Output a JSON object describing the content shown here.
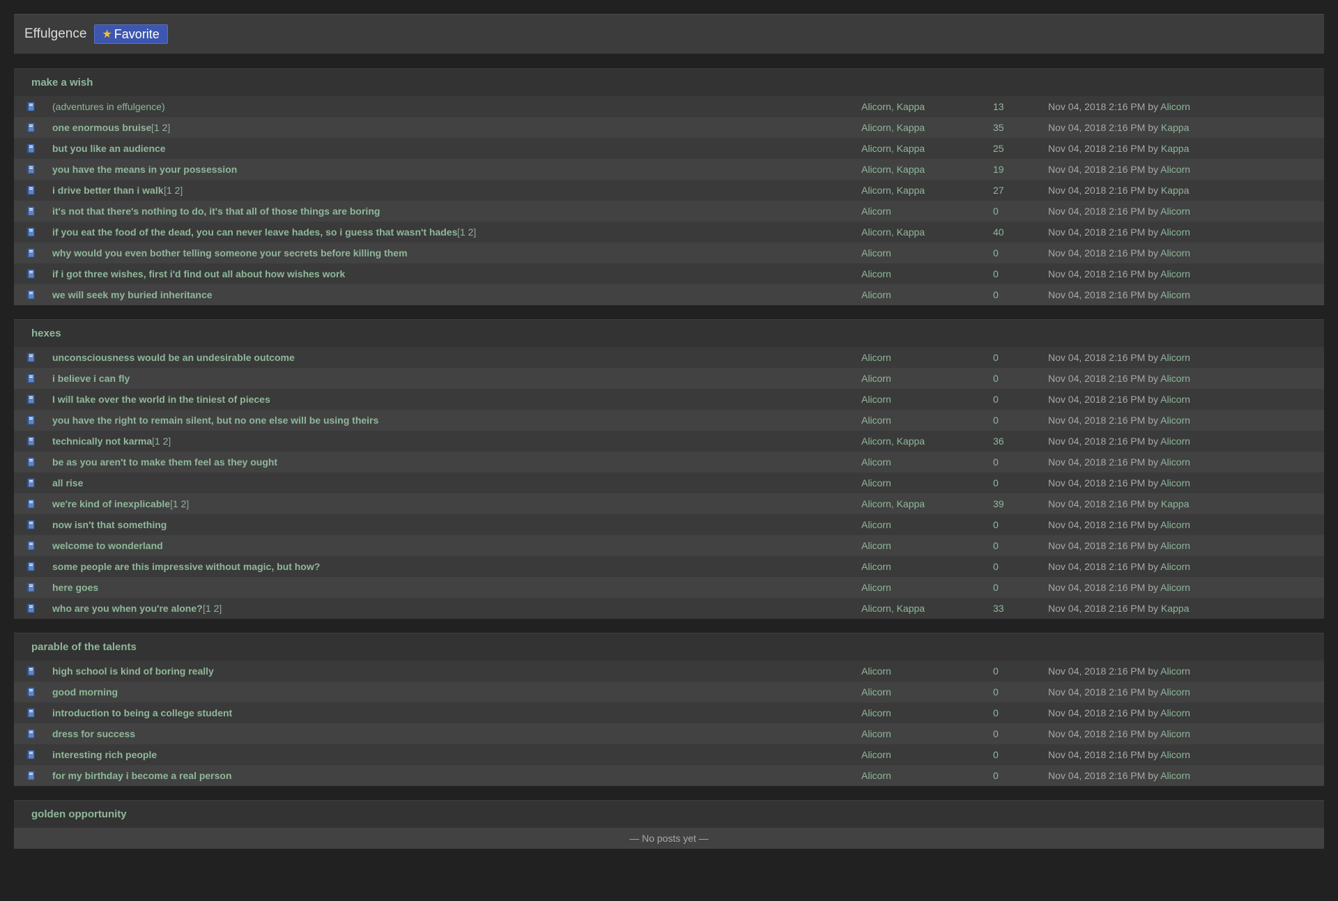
{
  "header": {
    "title": "Effulgence",
    "favorite_label": "Favorite"
  },
  "sections": [
    {
      "name": "make a wish",
      "rows": [
        {
          "title": "(adventures in effulgence)",
          "plain": true,
          "pages": null,
          "authors": [
            "Alicorn",
            "Kappa"
          ],
          "count": "13",
          "date": "Nov 04, 2018 2:16 PM",
          "by": "by",
          "last_author": "Alicorn"
        },
        {
          "title": "one enormous bruise",
          "pages": [
            "1",
            "2"
          ],
          "authors": [
            "Alicorn",
            "Kappa"
          ],
          "count": "35",
          "date": "Nov 04, 2018 2:16 PM",
          "by": "by",
          "last_author": "Kappa"
        },
        {
          "title": "but you like an audience",
          "pages": null,
          "authors": [
            "Alicorn",
            "Kappa"
          ],
          "count": "25",
          "date": "Nov 04, 2018 2:16 PM",
          "by": "by",
          "last_author": "Kappa"
        },
        {
          "title": "you have the means in your possession",
          "pages": null,
          "authors": [
            "Alicorn",
            "Kappa"
          ],
          "count": "19",
          "date": "Nov 04, 2018 2:16 PM",
          "by": "by",
          "last_author": "Alicorn"
        },
        {
          "title": "i drive better than i walk",
          "pages": [
            "1",
            "2"
          ],
          "authors": [
            "Alicorn",
            "Kappa"
          ],
          "count": "27",
          "date": "Nov 04, 2018 2:16 PM",
          "by": "by",
          "last_author": "Kappa"
        },
        {
          "title": "it's not that there's nothing to do, it's that all of those things are boring",
          "pages": null,
          "authors": [
            "Alicorn"
          ],
          "count": "0",
          "date": "Nov 04, 2018 2:16 PM",
          "by": "by",
          "last_author": "Alicorn"
        },
        {
          "title": "if you eat the food of the dead, you can never leave hades, so i guess that wasn't hades",
          "pages": [
            "1",
            "2"
          ],
          "authors": [
            "Alicorn",
            "Kappa"
          ],
          "count": "40",
          "date": "Nov 04, 2018 2:16 PM",
          "by": "by",
          "last_author": "Alicorn"
        },
        {
          "title": "why would you even bother telling someone your secrets before killing them",
          "pages": null,
          "authors": [
            "Alicorn"
          ],
          "count": "0",
          "date": "Nov 04, 2018 2:16 PM",
          "by": "by",
          "last_author": "Alicorn"
        },
        {
          "title": "if i got three wishes, first i'd find out all about how wishes work",
          "pages": null,
          "authors": [
            "Alicorn"
          ],
          "count": "0",
          "date": "Nov 04, 2018 2:16 PM",
          "by": "by",
          "last_author": "Alicorn"
        },
        {
          "title": "we will seek my buried inheritance",
          "pages": null,
          "authors": [
            "Alicorn"
          ],
          "count": "0",
          "date": "Nov 04, 2018 2:16 PM",
          "by": "by",
          "last_author": "Alicorn"
        }
      ]
    },
    {
      "name": "hexes",
      "rows": [
        {
          "title": "unconsciousness would be an undesirable outcome",
          "pages": null,
          "authors": [
            "Alicorn"
          ],
          "count": "0",
          "date": "Nov 04, 2018 2:16 PM",
          "by": "by",
          "last_author": "Alicorn"
        },
        {
          "title": "i believe i can fly",
          "pages": null,
          "authors": [
            "Alicorn"
          ],
          "count": "0",
          "date": "Nov 04, 2018 2:16 PM",
          "by": "by",
          "last_author": "Alicorn"
        },
        {
          "title": "I will take over the world in the tiniest of pieces",
          "pages": null,
          "authors": [
            "Alicorn"
          ],
          "count": "0",
          "date": "Nov 04, 2018 2:16 PM",
          "by": "by",
          "last_author": "Alicorn"
        },
        {
          "title": "you have the right to remain silent, but no one else will be using theirs",
          "pages": null,
          "authors": [
            "Alicorn"
          ],
          "count": "0",
          "date": "Nov 04, 2018 2:16 PM",
          "by": "by",
          "last_author": "Alicorn"
        },
        {
          "title": "technically not karma",
          "pages": [
            "1",
            "2"
          ],
          "authors": [
            "Alicorn",
            "Kappa"
          ],
          "count": "36",
          "date": "Nov 04, 2018 2:16 PM",
          "by": "by",
          "last_author": "Alicorn"
        },
        {
          "title": "be as you aren't to make them feel as they ought",
          "pages": null,
          "authors": [
            "Alicorn"
          ],
          "count": "0",
          "date": "Nov 04, 2018 2:16 PM",
          "by": "by",
          "last_author": "Alicorn"
        },
        {
          "title": "all rise",
          "pages": null,
          "authors": [
            "Alicorn"
          ],
          "count": "0",
          "date": "Nov 04, 2018 2:16 PM",
          "by": "by",
          "last_author": "Alicorn"
        },
        {
          "title": "we're kind of inexplicable",
          "pages": [
            "1",
            "2"
          ],
          "authors": [
            "Alicorn",
            "Kappa"
          ],
          "count": "39",
          "date": "Nov 04, 2018 2:16 PM",
          "by": "by",
          "last_author": "Kappa"
        },
        {
          "title": "now isn't that something",
          "pages": null,
          "authors": [
            "Alicorn"
          ],
          "count": "0",
          "date": "Nov 04, 2018 2:16 PM",
          "by": "by",
          "last_author": "Alicorn"
        },
        {
          "title": "welcome to wonderland",
          "pages": null,
          "authors": [
            "Alicorn"
          ],
          "count": "0",
          "date": "Nov 04, 2018 2:16 PM",
          "by": "by",
          "last_author": "Alicorn"
        },
        {
          "title": "some people are this impressive without magic, but how?",
          "pages": null,
          "authors": [
            "Alicorn"
          ],
          "count": "0",
          "date": "Nov 04, 2018 2:16 PM",
          "by": "by",
          "last_author": "Alicorn"
        },
        {
          "title": "here goes",
          "pages": null,
          "authors": [
            "Alicorn"
          ],
          "count": "0",
          "date": "Nov 04, 2018 2:16 PM",
          "by": "by",
          "last_author": "Alicorn"
        },
        {
          "title": "who are you when you're alone?",
          "pages": [
            "1",
            "2"
          ],
          "authors": [
            "Alicorn",
            "Kappa"
          ],
          "count": "33",
          "date": "Nov 04, 2018 2:16 PM",
          "by": "by",
          "last_author": "Kappa"
        }
      ]
    },
    {
      "name": "parable of the talents",
      "rows": [
        {
          "title": "high school is kind of boring really",
          "pages": null,
          "authors": [
            "Alicorn"
          ],
          "count": "0",
          "date": "Nov 04, 2018 2:16 PM",
          "by": "by",
          "last_author": "Alicorn"
        },
        {
          "title": "good morning",
          "pages": null,
          "authors": [
            "Alicorn"
          ],
          "count": "0",
          "date": "Nov 04, 2018 2:16 PM",
          "by": "by",
          "last_author": "Alicorn"
        },
        {
          "title": "introduction to being a college student",
          "pages": null,
          "authors": [
            "Alicorn"
          ],
          "count": "0",
          "date": "Nov 04, 2018 2:16 PM",
          "by": "by",
          "last_author": "Alicorn"
        },
        {
          "title": "dress for success",
          "pages": null,
          "authors": [
            "Alicorn"
          ],
          "count": "0",
          "date": "Nov 04, 2018 2:16 PM",
          "by": "by",
          "last_author": "Alicorn"
        },
        {
          "title": "interesting rich people",
          "pages": null,
          "authors": [
            "Alicorn"
          ],
          "count": "0",
          "date": "Nov 04, 2018 2:16 PM",
          "by": "by",
          "last_author": "Alicorn"
        },
        {
          "title": "for my birthday i become a real person",
          "pages": null,
          "authors": [
            "Alicorn"
          ],
          "count": "0",
          "date": "Nov 04, 2018 2:16 PM",
          "by": "by",
          "last_author": "Alicorn"
        }
      ]
    },
    {
      "name": "golden opportunity",
      "rows": [],
      "empty_text": "— No posts yet —"
    }
  ],
  "icons": {
    "post": "book-icon",
    "favorite": "star-icon"
  },
  "colors": {
    "background": "#212121",
    "panel": "#3c3c3c",
    "link": "#8fb89a",
    "button": "#3d56b0"
  }
}
